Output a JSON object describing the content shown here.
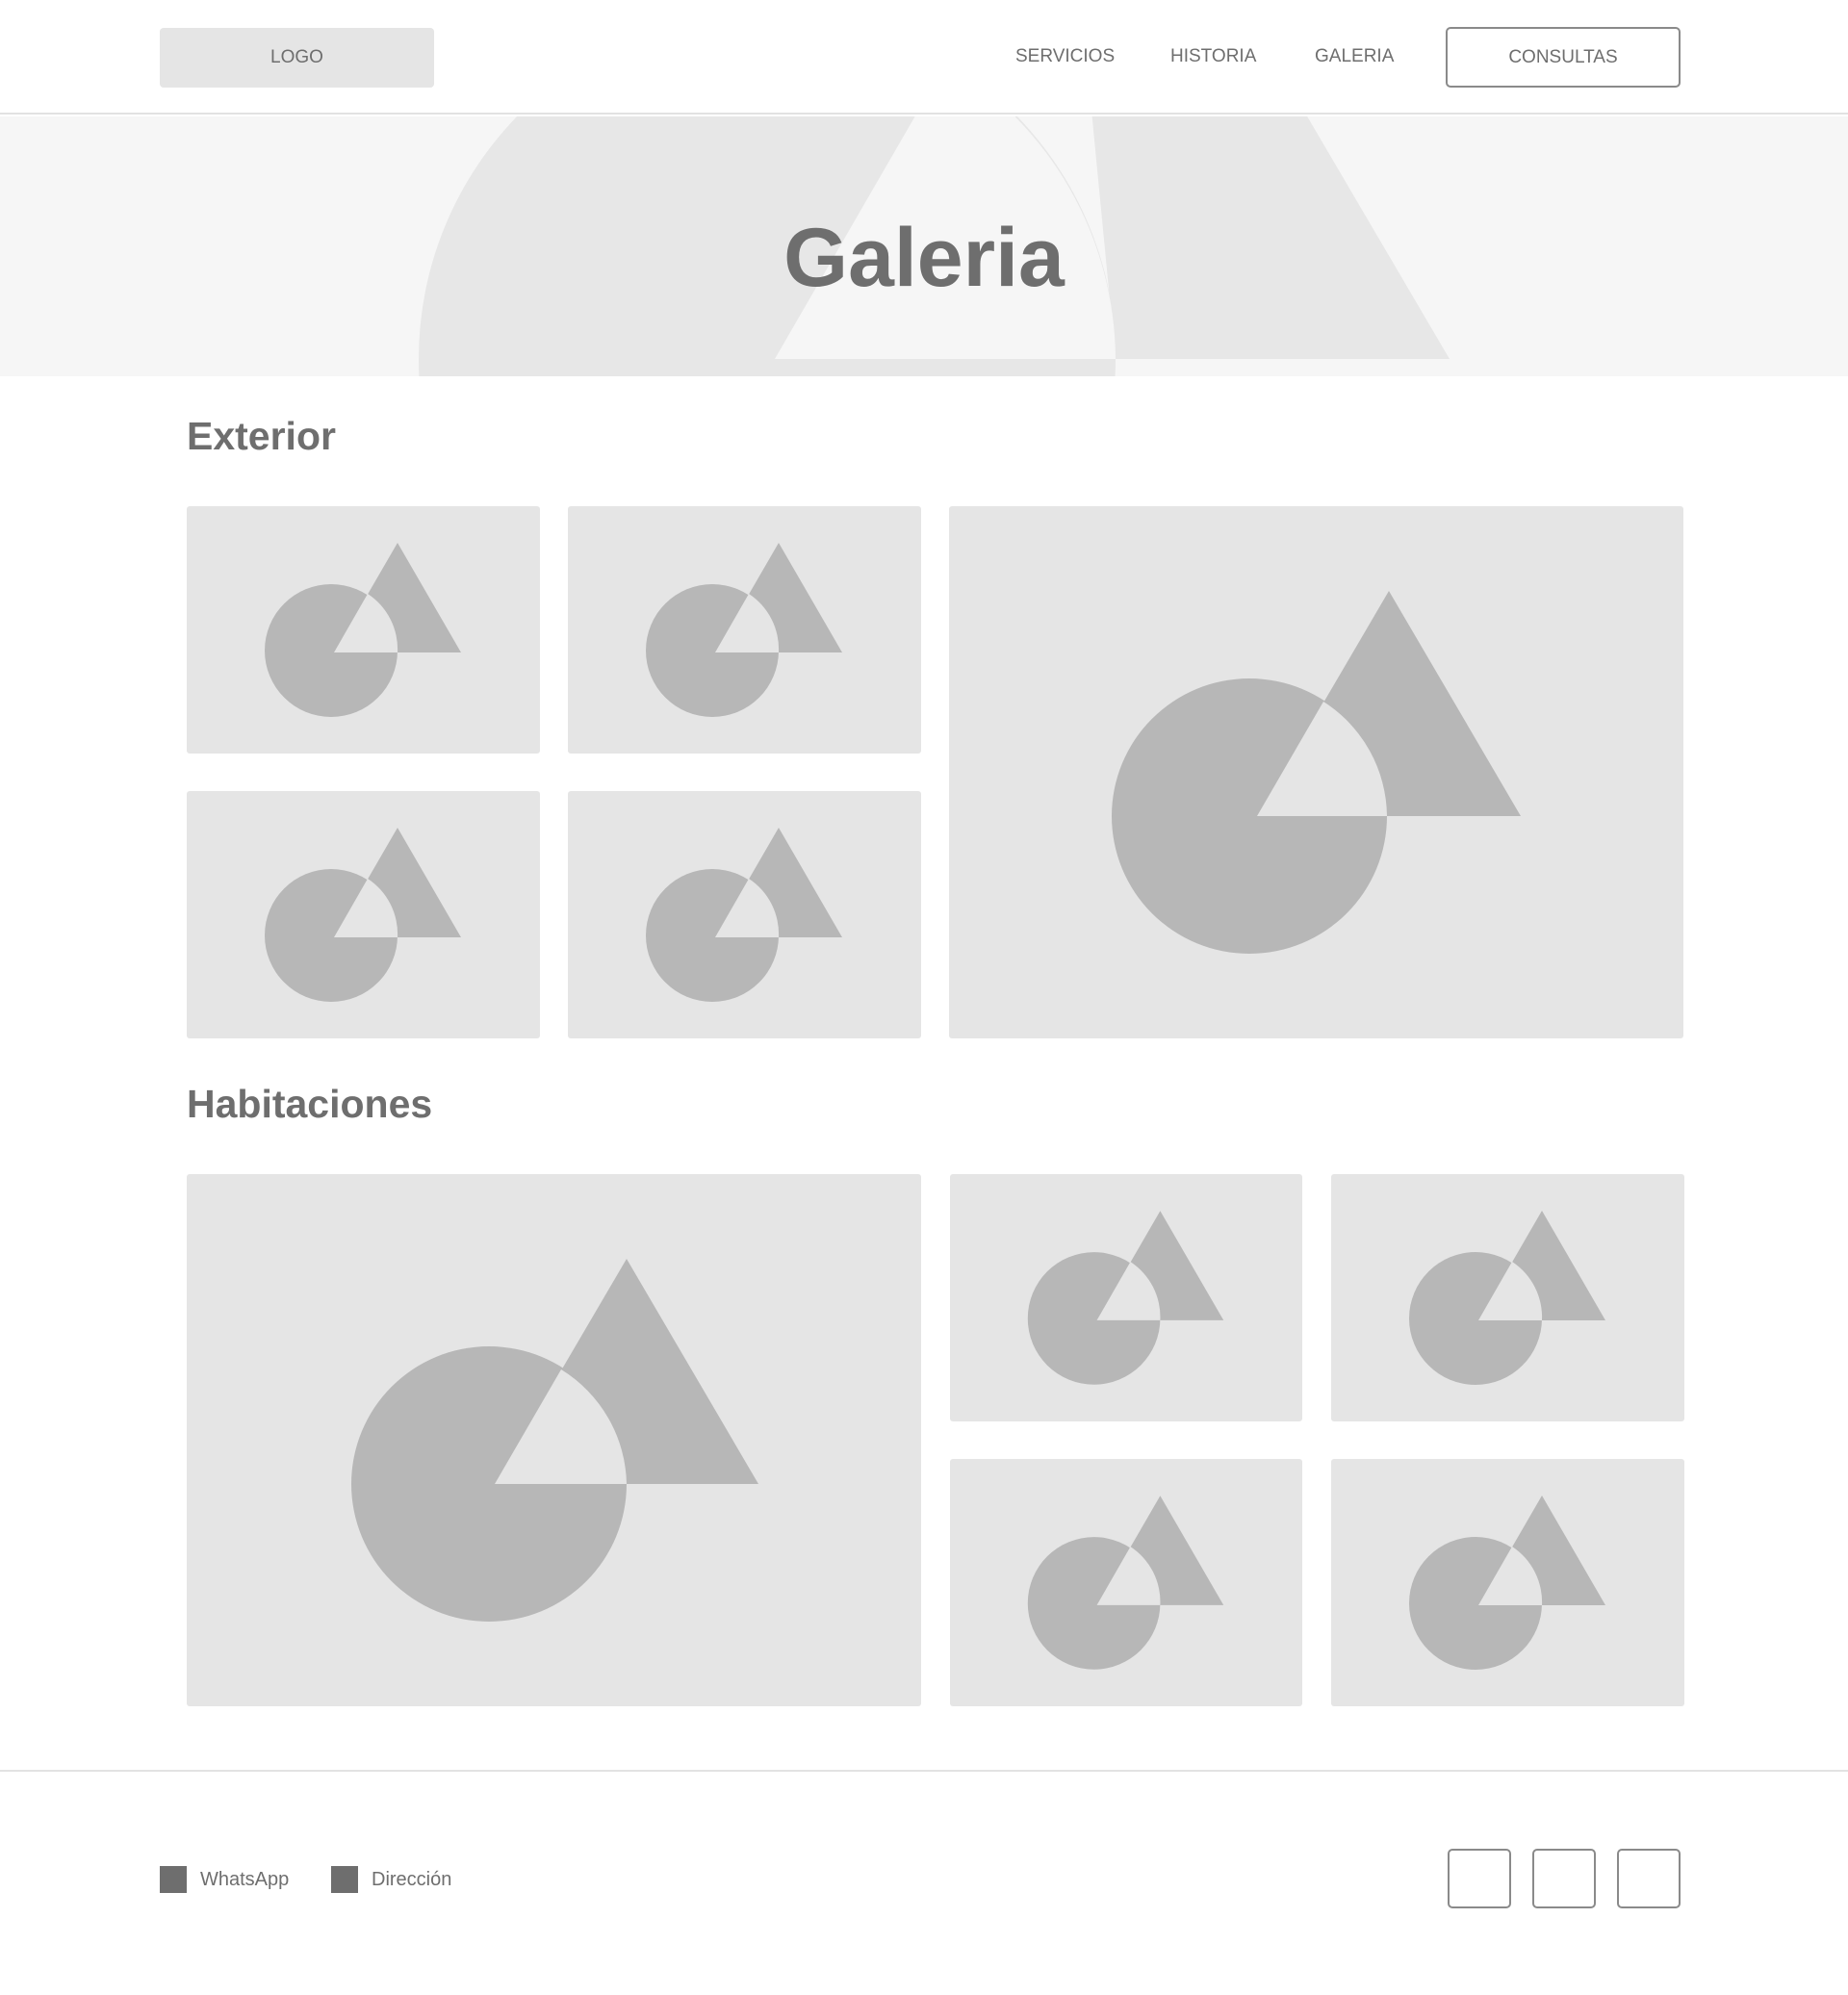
{
  "header": {
    "logo_label": "LOGO",
    "nav": [
      {
        "label": "SERVICIOS"
      },
      {
        "label": "HISTORIA"
      },
      {
        "label": "GALERIA"
      }
    ],
    "cta_label": "CONSULTAS"
  },
  "hero": {
    "title": "Galeria",
    "background_icon": "image-placeholder-icon"
  },
  "sections": [
    {
      "title": "Exterior",
      "image_icon": "image-placeholder-icon",
      "image_count": 5
    },
    {
      "title": "Habitaciones",
      "image_icon": "image-placeholder-icon",
      "image_count": 5
    }
  ],
  "footer": {
    "contacts": [
      {
        "label": "WhatsApp",
        "icon": "whatsapp-icon"
      },
      {
        "label": "Dirección",
        "icon": "location-icon"
      }
    ],
    "social_buttons": [
      "social-button",
      "social-button",
      "social-button"
    ]
  },
  "colors": {
    "text": "#6e6e6e",
    "placeholder_bg": "#e5e5e5",
    "placeholder_shape": "#b7b7b7",
    "hero_bg": "#f6f6f6",
    "divider": "#e2e2e2"
  }
}
